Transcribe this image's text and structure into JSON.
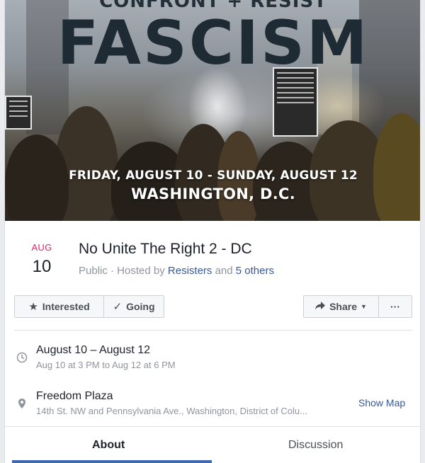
{
  "cover": {
    "top_text": "CONFRONT + RESIST",
    "headline": "FASCISM",
    "dates_line": "FRIDAY, AUGUST 10 - SUNDAY, AUGUST 12",
    "city_line": "WASHINGTON, D.C."
  },
  "event": {
    "month": "AUG",
    "day": "10",
    "title": "No Unite The Right 2 - DC",
    "meta_prefix": "Public · Hosted by ",
    "host": "Resisters",
    "meta_and": " and ",
    "others": "5 others"
  },
  "actions": {
    "interested": "Interested",
    "going": "Going",
    "share": "Share",
    "more": "···"
  },
  "details": {
    "time_main": "August 10 – August 12",
    "time_sub": "Aug 10 at 3 PM to Aug 12 at 6 PM",
    "place_main": "Freedom Plaza",
    "place_sub": "14th St. NW and Pennsylvania Ave., Washington, District of Colu...",
    "show_map": "Show Map"
  },
  "tabs": [
    {
      "label": "About"
    },
    {
      "label": "Discussion"
    }
  ],
  "colors": {
    "date_accent": "#e0245e",
    "link": "#365899",
    "tab_active": "#4267b2"
  }
}
